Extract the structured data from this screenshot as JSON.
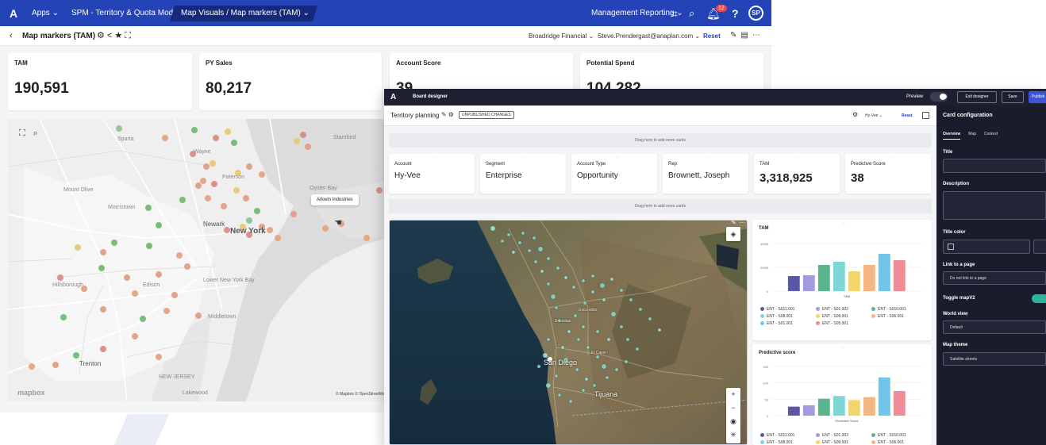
{
  "back_window": {
    "topbar": {
      "logo": "A",
      "apps": "Apps",
      "app_name": "SPM - Territory & Quota Modeling App",
      "page": "Map Visuals / Map markers (TAM)",
      "management": "Management Reporting",
      "notification_count": "12",
      "avatar": "SP",
      "color": "#2343b6"
    },
    "subbar": {
      "title": "Map markers (TAM)",
      "filter_company": "Broadridge Financial",
      "filter_user": "Steve.Prendergast@anaplan.com",
      "reset": "Reset"
    },
    "kpis": [
      {
        "label": "TAM",
        "value": "190,591"
      },
      {
        "label": "PY Sales",
        "value": "80,217"
      },
      {
        "label": "Account Score",
        "value": "39"
      },
      {
        "label": "Potential Spend",
        "value": "104,282"
      }
    ],
    "map": {
      "tooltip": "Arkwin Industries",
      "city_labels": [
        "New York",
        "Newark",
        "Trenton"
      ],
      "place_labels": [
        "Sparta",
        "Mount Olive",
        "Morristown",
        "Wayne",
        "Paterson",
        "Oyster Bay",
        "Stamford",
        "Hillsborough",
        "Edison",
        "Lower New York Bay",
        "Middletown",
        "NEW JERSEY",
        "Lakewood"
      ],
      "logo": "mapbox",
      "attribution": "© Mapbox © OpenStreetMap"
    }
  },
  "front_window": {
    "topbar": {
      "logo": "A",
      "title": "Board designer",
      "preview": "Preview",
      "exit": "Exit designer",
      "save": "Save",
      "publish": "Publish"
    },
    "subbar": {
      "title": "Territory planning",
      "badge": "UNPUBLISHED CHANGES",
      "filter": "Hy-Vee",
      "reset": "Reset"
    },
    "drop_hint": "Drag here to add more cards",
    "cards": [
      {
        "label": "Account",
        "value": "Hy-Vee"
      },
      {
        "label": "Segment",
        "value": "Enterprise"
      },
      {
        "label": "Account Type",
        "value": "Opportunity"
      },
      {
        "label": "Rep",
        "value": "Brownett, Joseph"
      },
      {
        "label": "TAM",
        "value": "3,318,925"
      },
      {
        "label": "Predictive Score",
        "value": "38"
      }
    ],
    "satellite": {
      "cities": [
        "San Diego",
        "Tijuana",
        "Escondido",
        "Encinitas",
        "El Cajon"
      ]
    },
    "tam_chart": {
      "title": "TAM",
      "xlabel": "TAM",
      "ticks": [
        "400M",
        "200M",
        "0"
      ]
    },
    "score_chart": {
      "title": "Predictive score",
      "xlabel": "Predictive Score",
      "ticks": [
        "150",
        "100",
        "50",
        "0"
      ]
    },
    "legend": [
      {
        "label": "ENT - S011.001",
        "color": "#5b57a7"
      },
      {
        "label": "ENT - S01.002",
        "color": "#a29be0"
      },
      {
        "label": "ENT - S010.001",
        "color": "#58b58c"
      },
      {
        "label": "ENT - S08.001",
        "color": "#7fd6d6"
      },
      {
        "label": "ENT - S09.001",
        "color": "#f3d66a"
      },
      {
        "label": "ENT - S06.001",
        "color": "#f5b682"
      },
      {
        "label": "ENT - S01.001",
        "color": "#6fc6e8"
      },
      {
        "label": "ENT - S05.001",
        "color": "#ee8c98"
      }
    ],
    "config": {
      "title": "Card configuration",
      "tabs": [
        "Overview",
        "Map",
        "Context"
      ],
      "active_tab": "Overview",
      "field_title": "Title",
      "field_description": "Description",
      "field_title_color": "Title color",
      "field_link": "Link to a page",
      "link_value": "Do not link to a page",
      "toggle_label": "Toggle mapV2",
      "world_view_label": "World view",
      "world_view_value": "Default",
      "theme_label": "Map theme",
      "theme_value": "Satellite streets"
    }
  },
  "chart_data": [
    {
      "type": "bar",
      "title": "TAM",
      "xlabel": "TAM",
      "categories": [
        "ENT - S011.001",
        "ENT - S01.002",
        "ENT - S010.001",
        "ENT - S08.001",
        "ENT - S09.001",
        "ENT - S06.001",
        "ENT - S01.001",
        "ENT - S05.001"
      ],
      "values": [
        190,
        200,
        330,
        370,
        250,
        330,
        470,
        390
      ]
    },
    {
      "type": "bar",
      "title": "Predictive score",
      "xlabel": "Predictive Score",
      "categories": [
        "ENT - S011.001",
        "ENT - S01.002",
        "ENT - S010.001",
        "ENT - S08.001",
        "ENT - S09.001",
        "ENT - S06.001",
        "ENT - S01.001",
        "ENT - S05.001"
      ],
      "values": [
        33,
        38,
        62,
        72,
        57,
        68,
        140,
        90
      ]
    }
  ]
}
